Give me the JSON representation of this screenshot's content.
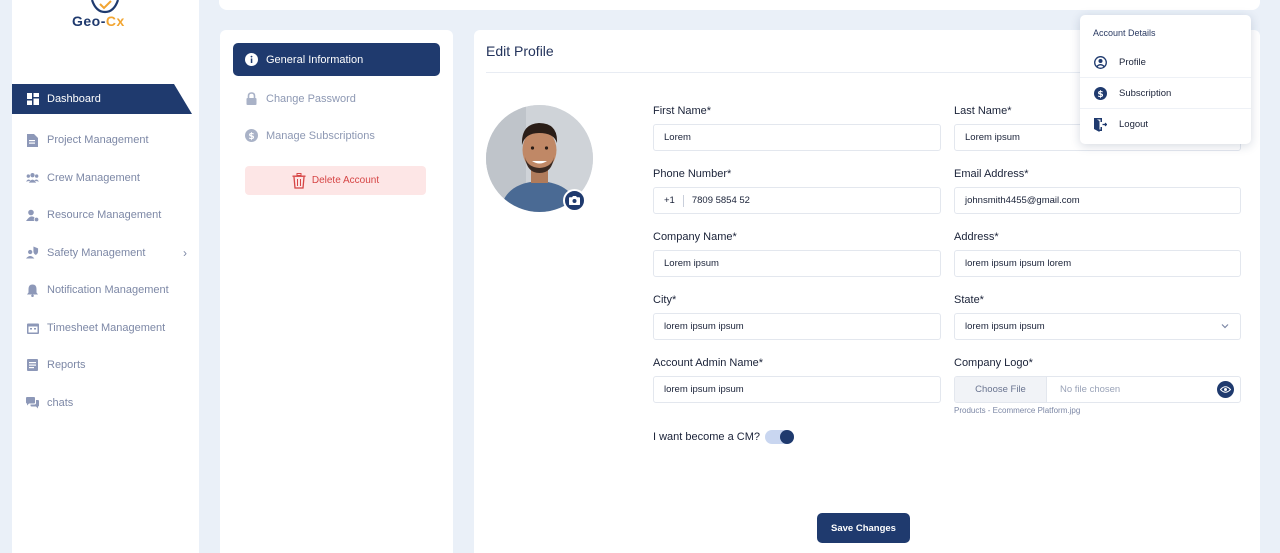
{
  "brand": {
    "part1": "Geo-",
    "part2": "Cx"
  },
  "sidebar": {
    "items": [
      {
        "label": "Dashboard",
        "icon": "dashboard-icon",
        "active": true
      },
      {
        "label": "Project Management",
        "icon": "document-icon"
      },
      {
        "label": "Crew Management",
        "icon": "users-icon"
      },
      {
        "label": "Resource Management",
        "icon": "user-gear-icon"
      },
      {
        "label": "Safety Management",
        "icon": "safety-icon",
        "has_submenu": true
      },
      {
        "label": "Notification Management",
        "icon": "bell-icon"
      },
      {
        "label": "Timesheet Management",
        "icon": "calendar-icon"
      },
      {
        "label": "Reports",
        "icon": "report-icon"
      },
      {
        "label": "chats",
        "icon": "chat-icon"
      }
    ]
  },
  "settings": {
    "general": "General Information",
    "password": "Change Password",
    "subscriptions": "Manage Subscriptions",
    "delete": "Delete Account"
  },
  "profile": {
    "title": "Edit Profile",
    "first_name": {
      "label": "First Name*",
      "value": "Lorem"
    },
    "last_name": {
      "label": "Last Name*",
      "value": "Lorem ipsum"
    },
    "phone": {
      "label": "Phone Number*",
      "code": "+1",
      "value": "7809 5854 52"
    },
    "email": {
      "label": "Email Address*",
      "value": "johnsmith4455@gmail.com"
    },
    "company": {
      "label": "Company Name*",
      "value": "Lorem ipsum"
    },
    "address": {
      "label": "Address*",
      "value": "lorem ipsum ipsum lorem"
    },
    "city": {
      "label": "City*",
      "value": "lorem ipsum ipsum"
    },
    "state": {
      "label": "State*",
      "value": "lorem ipsum ipsum"
    },
    "admin_name": {
      "label": "Account Admin Name*",
      "value": "lorem ipsum ipsum"
    },
    "logo": {
      "label": "Company Logo*",
      "button": "Choose File",
      "status": "No file chosen",
      "hint": "Products - Ecommerce Platform.jpg"
    },
    "cm_toggle": {
      "label": "I want become a CM?",
      "on": true
    },
    "save": "Save Changes"
  },
  "account_menu": {
    "title": "Account Details",
    "items": [
      {
        "label": "Profile",
        "icon": "user-circle-icon"
      },
      {
        "label": "Subscription",
        "icon": "dollar-icon"
      },
      {
        "label": "Logout",
        "icon": "logout-icon"
      }
    ]
  },
  "colors": {
    "primary": "#1f3a6e",
    "accent": "#f2a531",
    "danger": "#d64545",
    "danger_bg": "#fde6e6"
  }
}
